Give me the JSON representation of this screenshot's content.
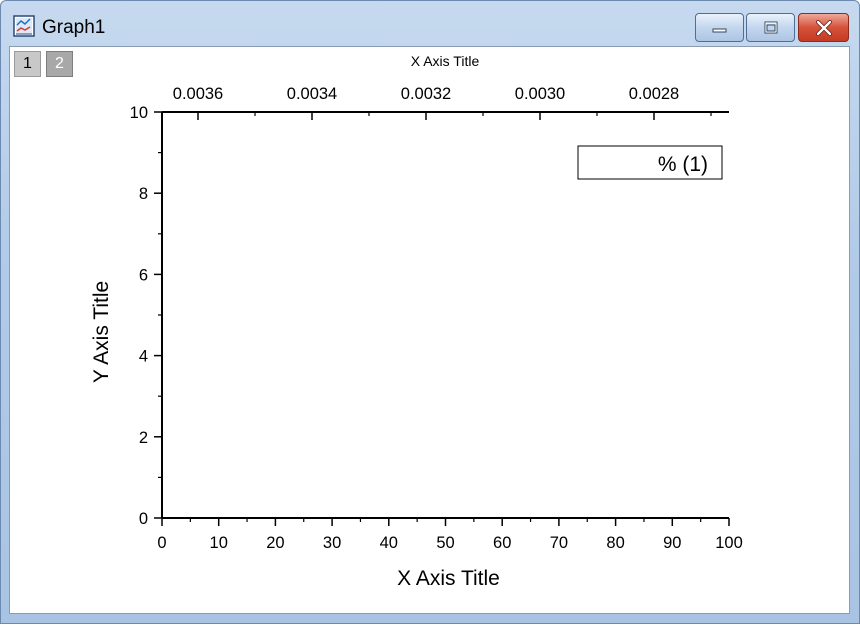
{
  "window": {
    "title": "Graph1",
    "accent_color": "#b2cbe8",
    "close_color": "#d6523b"
  },
  "layers": [
    {
      "label": "1",
      "active": true
    },
    {
      "label": "2",
      "active": false
    }
  ],
  "chart_data": {
    "type": "scatter",
    "series": [],
    "xlabel": "X Axis Title",
    "ylabel": "Y Axis Title",
    "xlim": [
      0,
      100
    ],
    "ylim": [
      0,
      10
    ],
    "x_ticks": [
      "0",
      "10",
      "20",
      "30",
      "40",
      "50",
      "60",
      "70",
      "80",
      "90",
      "100"
    ],
    "y_ticks": [
      "0",
      "2",
      "4",
      "6",
      "8",
      "10"
    ],
    "top_axis": {
      "title": "X Axis Title",
      "scale": "reciprocal",
      "ticks": [
        "0.0036",
        "0.0034",
        "0.0032",
        "0.0030",
        "0.0028"
      ]
    },
    "legend": {
      "text": "% (1)",
      "position": "top-right"
    },
    "grid": false
  }
}
